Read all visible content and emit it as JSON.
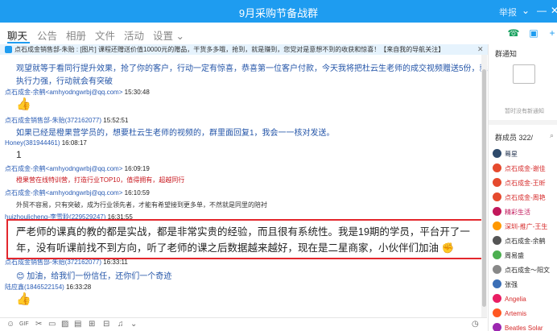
{
  "title_bar": {
    "title": "9月采购节备战群",
    "user": "举报"
  },
  "tabs": [
    {
      "label": "聊天"
    },
    {
      "label": "公告"
    },
    {
      "label": "相册"
    },
    {
      "label": "文件"
    },
    {
      "label": "活动"
    },
    {
      "label": "设置 ⌄"
    }
  ],
  "notice": {
    "text": "点石成金销售部-朱贻 : [图片] 课程还赠送价值10000元的赠品，干货多多哦，抢到，就是赚到，您党对是意想不到的收获和惊喜！【来自我的导航关注】"
  },
  "messages": [
    {
      "text": "观望就等于看同行提升效果，抢了你的客户，行动一定有惊喜，恭喜第一位客户付款，今天我将把杜云生老师的成交视频赠送5份，就看谁的"
    },
    {
      "text": "执行力强，行动就会有突破"
    },
    {
      "sender": "点石成金-余鹤<amhyodngwrbj@qq.com>",
      "time": "15:30:48"
    },
    {
      "sender": "点石成金销售部-朱贻(372162077)",
      "time": "15:52:51"
    },
    {
      "text": "如果已经是橙果营学员的，想要杜云生老师的视频的，群里面回复1，我会一一核对发送。"
    },
    {
      "sender": "Honey(381944461)",
      "time": "16:08:17"
    },
    {
      "text": "1"
    },
    {
      "sender": "点石成金-余鹤<amhyodngwrbj@qq.com>",
      "time": "16:09:19"
    },
    {
      "text": "橙果营在线特训营，打造行业TOP10，值得拥有，超越同行"
    },
    {
      "sender": "点石成金-余鹤<amhyodngwrbj@qq.com>",
      "time": "16:10:59"
    },
    {
      "text": "外贸不容易，只有突破，成为行业领先者，才能有希望接到更多单，不然就是同里的陪衬"
    },
    {
      "sender": "huizhoulicheng-李雪聆(229529247)",
      "time": "16:31:55"
    },
    {
      "text": "严老师的课真的教的都是实战，都是非常实贵的经验，而且很有系统性。我是19期的学员，平台开了一年，没有听课前找不到方向，听了老师的课之后数据越来越好，现在是二星商家，小伙伴们加油"
    },
    {
      "sender": "点石成金销售部-朱贻(372162077)",
      "time": "16:33:11"
    },
    {
      "text": "加油，给我们一份信任，还你们一个奇迹"
    },
    {
      "sender": "陆应鑫(1846522154)",
      "time": "16:33:28"
    }
  ],
  "right_panel": {
    "notice_title": "群通知",
    "no_notice": "暂时没有新通知",
    "members_title": "群成员 322/",
    "members": [
      {
        "name": "蓦星",
        "color": "#2a3a55"
      },
      {
        "name": "点石成金-谢佳",
        "color": "#d62b2b"
      },
      {
        "name": "点石成金-王昕",
        "color": "#d62b2b"
      },
      {
        "name": "点石成金-周艳",
        "color": "#d62b2b"
      },
      {
        "name": "精彩生活",
        "color": "#c2185b"
      },
      {
        "name": "深圳-推广-王生",
        "color": "#d62b2b"
      },
      {
        "name": "点石成金-余鹤",
        "color": "#2a2a2a"
      },
      {
        "name": "周易盛",
        "color": "#2a2a2a"
      },
      {
        "name": "点石成金～阳文",
        "color": "#2a2a2a"
      },
      {
        "name": "张强",
        "color": "#2a2a2a"
      },
      {
        "name": "Angelia",
        "color": "#d62b2b"
      },
      {
        "name": "Artemis",
        "color": "#d62b2b"
      },
      {
        "name": "Beatles Solar",
        "color": "#d62b2b"
      }
    ]
  },
  "colors": {
    "accent": "#1e9cf0",
    "highlight_border": "#e3272d"
  }
}
